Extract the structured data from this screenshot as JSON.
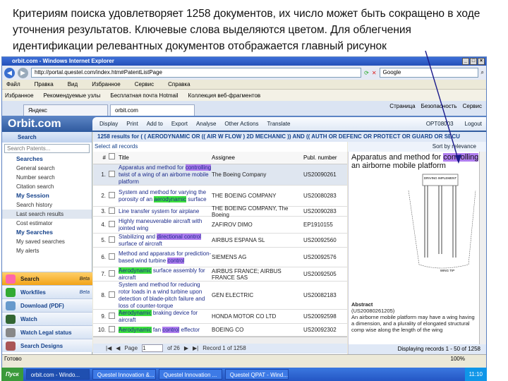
{
  "caption": "Критериям поиска удовлетворяет 1258 документов, их число может быть сокращено в ходе уточнения результатов. Ключевые слова выделяются цветом. Для облегчения идентификации релевантных документов  отображается главный рисунок",
  "browser": {
    "title": "orbit.com - Windows Internet Explorer",
    "url": "http://portal.questel.com/index.htm#PatentListPage",
    "search_placeholder": "Google",
    "menu": [
      "Файл",
      "Правка",
      "Вид",
      "Избранное",
      "Сервис",
      "Справка"
    ],
    "favorites": [
      "Избранное",
      "Рекомендуемые узлы",
      "Бесплатная почта Hotmail",
      "Коллекция веб-фрагментов"
    ],
    "tabs": [
      "Яндекс",
      "orbit.com"
    ],
    "tools": [
      "Страница",
      "Безопасность",
      "Сервис"
    ]
  },
  "orbit": {
    "logo": "Orbit.com",
    "toolbar": [
      "Display",
      "Print",
      "Add to",
      "Export",
      "Analyse",
      "Other Actions",
      "Translate"
    ],
    "user": "OPT08003",
    "logout": "Logout"
  },
  "sidebar": {
    "title": "Search",
    "search_placeholder": "Search Patents...",
    "items": [
      {
        "label": "Searches",
        "group": true
      },
      {
        "label": "General search"
      },
      {
        "label": "Number search"
      },
      {
        "label": "Citation search"
      },
      {
        "label": "My Session",
        "group": true
      },
      {
        "label": "Search history"
      },
      {
        "label": "Last search results",
        "selected": true
      },
      {
        "label": "Cost estimator"
      },
      {
        "label": "My Searches",
        "group": true
      },
      {
        "label": "My saved searches"
      },
      {
        "label": "My alerts"
      }
    ],
    "accordion": [
      {
        "label": "Search",
        "badge": "Beta",
        "active": true
      },
      {
        "label": "Workfiles",
        "badge": "Beta"
      },
      {
        "label": "Download (PDF)"
      },
      {
        "label": "Watch"
      },
      {
        "label": "Watch Legal status"
      },
      {
        "label": "Search Designs"
      }
    ]
  },
  "results": {
    "query": "1258 results for ( ( AERODYNAMIC OR (( AIR W FLOW ) 2D MECHANIC )) AND (( AUTH OR DEFENC OR PROTECT OR GUARD OR SECU",
    "select_all": "Select all records",
    "sort": "Sort by relevance",
    "columns": [
      "#",
      "Title",
      "Assignee",
      "Publ. number"
    ],
    "rows": [
      {
        "n": "1.",
        "title": [
          [
            "Apparatus and method for ",
            ""
          ],
          [
            "controlling",
            "p"
          ],
          [
            " twist of a wing of an airborne mobile platform",
            ""
          ]
        ],
        "assignee": "The Boeing Company",
        "pub": "US20090261"
      },
      {
        "n": "2.",
        "title": [
          [
            "System and method for varying the porosity of an ",
            ""
          ],
          [
            "aerodynamic",
            "g"
          ],
          [
            " surface",
            ""
          ]
        ],
        "assignee": "THE BOEING COMPANY",
        "pub": "US20080283"
      },
      {
        "n": "3.",
        "title": [
          [
            "Line transfer system for airplane",
            ""
          ]
        ],
        "assignee": "THE BOEING COMPANY, The Boeing",
        "pub": "US20090283"
      },
      {
        "n": "4.",
        "title": [
          [
            "Highly maneuverable aircraft with jointed wing",
            ""
          ]
        ],
        "assignee": "ZAFIROV DIMO",
        "pub": "EP1910155"
      },
      {
        "n": "5.",
        "title": [
          [
            "Stabilizing and ",
            ""
          ],
          [
            "directional control",
            "p"
          ],
          [
            " surface of aircraft",
            ""
          ]
        ],
        "assignee": "AIRBUS ESPANA SL",
        "pub": "US20092560"
      },
      {
        "n": "6.",
        "title": [
          [
            "Method and apparatus for prediction-based wind turbine ",
            ""
          ],
          [
            "control",
            "p"
          ]
        ],
        "assignee": "SIEMENS AG",
        "pub": "US20092576"
      },
      {
        "n": "7.",
        "title": [
          [
            "Aerodynamic",
            "g"
          ],
          [
            " surface assembly for aircraft",
            ""
          ]
        ],
        "assignee": "AIRBUS FRANCE; AIRBUS FRANCE SAS",
        "pub": "US20092505"
      },
      {
        "n": "8.",
        "title": [
          [
            "System and method for reducing rotor loads in a wind turbine upon detection of blade-pitch failure and loss of counter-torque",
            ""
          ]
        ],
        "assignee": "GEN ELECTRIC",
        "pub": "US20082183"
      },
      {
        "n": "9.",
        "title": [
          [
            "Aerodynamic",
            "g"
          ],
          [
            " braking device for aircraft",
            ""
          ]
        ],
        "assignee": "HONDA MOTOR CO LTD",
        "pub": "US20092598"
      },
      {
        "n": "10.",
        "title": [
          [
            "Aerodynamic",
            "g"
          ],
          [
            " fan ",
            ""
          ],
          [
            "control",
            "p"
          ],
          [
            " effector",
            ""
          ]
        ],
        "assignee": "BOEING CO",
        "pub": "US20092302"
      }
    ],
    "pager": {
      "page_label": "Page",
      "page": "1",
      "of": "of 26",
      "record": "Record 1 of 1258"
    },
    "displaying": "Displaying records 1 - 50 of 1258"
  },
  "preview": {
    "title_pre": "Apparatus and method for ",
    "title_hl": "controlling",
    "title_post": " an airborne mobile platform",
    "figure_label": "DRIVING IMPLEMENT",
    "figure_caption": "WING TIP",
    "abstract_label": "Abstract",
    "abstract_num": "(US20080261205)",
    "abstract": "An airborne mobile platform may have a wing having a dimension, and a plurality of elongated structural comp wise along the length of the wing"
  },
  "status": {
    "text": "Готово",
    "zoom": "100%"
  },
  "taskbar": {
    "start": "Пуск",
    "tasks": [
      "orbit.com - Windo...",
      "Questel Innovation &...",
      "Questel Innovation ...",
      "Questel QPAT - Wind..."
    ],
    "clock": "11:10"
  }
}
